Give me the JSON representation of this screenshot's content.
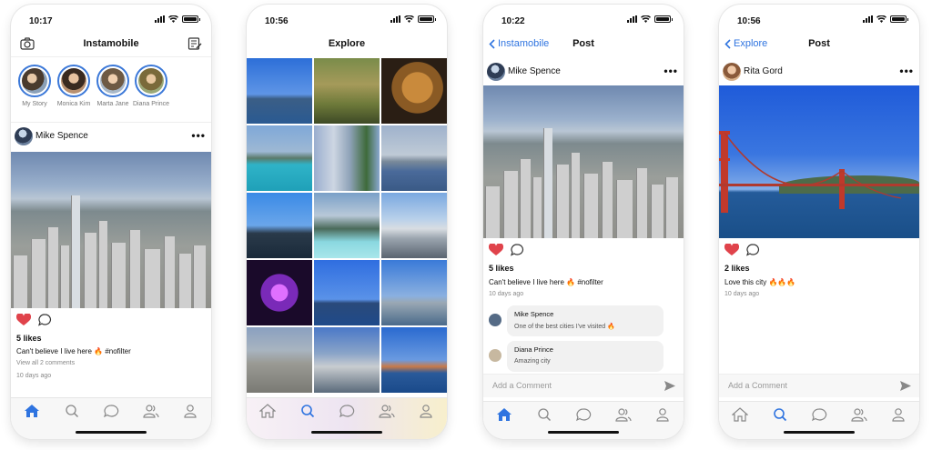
{
  "screens": [
    {
      "status_time": "10:17",
      "title": "Instamobile",
      "stories": [
        "My Story",
        "Monica Kim",
        "Marta Jane",
        "Diana Prince"
      ],
      "post": {
        "author": "Mike Spence",
        "likes": "5 likes",
        "caption": "Can't believe I live here 🔥 #nofilter",
        "view_comments": "View all 2 comments",
        "time_ago": "10 days ago"
      }
    },
    {
      "status_time": "10:56",
      "title": "Explore"
    },
    {
      "status_time": "10:22",
      "back_label": "Instamobile",
      "title": "Post",
      "post": {
        "author": "Mike Spence",
        "likes": "5 likes",
        "caption": "Can't believe I live here 🔥 #nofilter",
        "time_ago": "10 days ago"
      },
      "comments": [
        {
          "author": "Mike Spence",
          "text": "One of the best cities I've visited 🔥"
        },
        {
          "author": "Diana Prince",
          "text": "Amazing city"
        }
      ],
      "comment_placeholder": "Add a Comment"
    },
    {
      "status_time": "10:56",
      "back_label": "Explore",
      "title": "Post",
      "post": {
        "author": "Rita Gord",
        "likes": "2 likes",
        "caption": "Love this city 🔥🔥🔥",
        "time_ago": "10 days ago"
      },
      "comment_placeholder": "Add a Comment"
    }
  ],
  "colors": {
    "accent": "#2f74e0",
    "like": "#e0434b",
    "story_ring": "#3b78d8"
  },
  "icons": {
    "tabs": [
      "home-icon",
      "search-icon",
      "chat-icon",
      "users-icon",
      "profile-icon"
    ],
    "nav": [
      "camera-icon",
      "compose-icon",
      "back-chevron-icon",
      "more-icon",
      "send-icon",
      "heart-icon",
      "comment-icon"
    ]
  }
}
